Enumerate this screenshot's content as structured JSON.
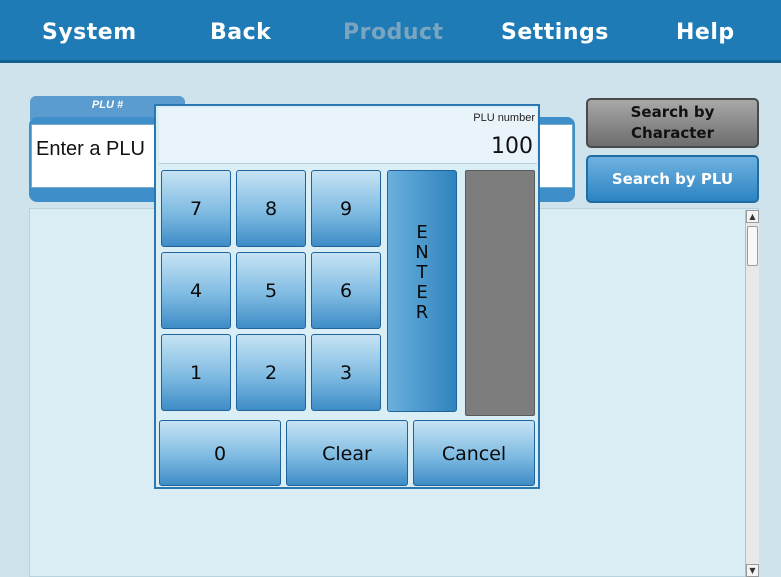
{
  "menu": {
    "system": "System",
    "back": "Back",
    "product": "Product",
    "settings": "Settings",
    "help": "Help"
  },
  "plu_field": {
    "tab_label": "PLU #",
    "value": "Enter a PLU"
  },
  "buttons": {
    "search_by_character_line1": "Search by",
    "search_by_character_line2": "Character",
    "search_by_plu": "Search by PLU"
  },
  "keypad": {
    "display_label": "PLU number",
    "display_value": "100",
    "keys": {
      "k7": "7",
      "k8": "8",
      "k9": "9",
      "k4": "4",
      "k5": "5",
      "k6": "6",
      "k1": "1",
      "k2": "2",
      "k3": "3",
      "k0": "0"
    },
    "enter_letters": [
      "E",
      "N",
      "T",
      "E",
      "R"
    ],
    "clear": "Clear",
    "cancel": "Cancel"
  },
  "colors": {
    "menubar": "#1f7bb6",
    "accent_blue": "#3e8cc6",
    "disabled_menu": "#7aa5c0"
  }
}
